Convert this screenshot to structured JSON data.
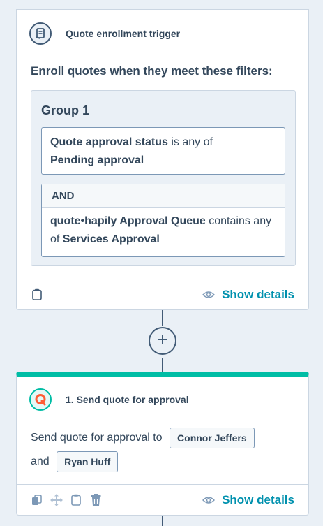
{
  "trigger": {
    "title": "Quote enrollment trigger",
    "enroll_heading": "Enroll quotes when they meet these filters:",
    "group_title": "Group 1",
    "filter1": {
      "property": "Quote approval status",
      "operator": " is any of ",
      "value": "Pending approval"
    },
    "and_label": "AND",
    "filter2": {
      "property": "quote•hapily Approval Queue",
      "operator": " contains any of ",
      "value": "Services Approval"
    },
    "show_details": "Show details"
  },
  "action": {
    "title": "1. Send quote for approval",
    "description": "Send quote for approval to",
    "approver1": "Connor Jeffers",
    "and_text": "and",
    "approver2": "Ryan Huff",
    "show_details": "Show details"
  },
  "icons": {
    "trigger": "document-scroll-icon",
    "action": "hapily-q-icon",
    "add": "plus-icon",
    "clone": "clone-icon",
    "move": "move-icon",
    "clipboard": "clipboard-icon",
    "delete": "trash-icon",
    "view": "eye-icon"
  },
  "colors": {
    "accent": "#00bda5",
    "link": "#0091ae",
    "text": "#33475b",
    "background": "#eaf0f6",
    "action_icon_accent": "#ff5c35"
  }
}
